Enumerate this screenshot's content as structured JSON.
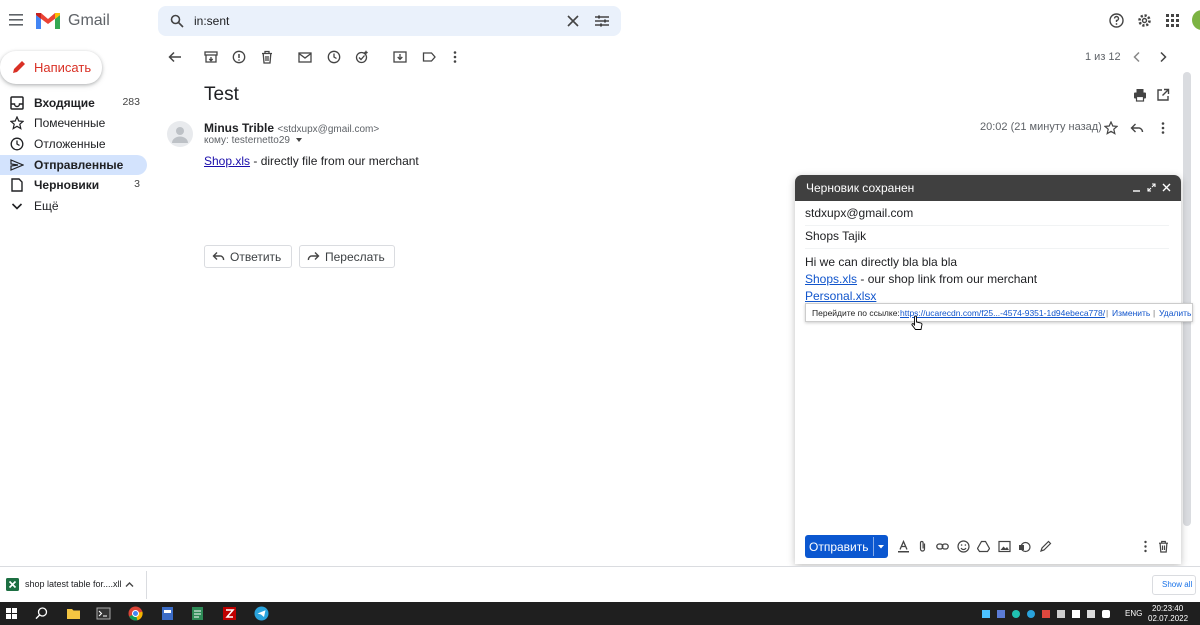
{
  "header": {
    "app_name": "Gmail",
    "search_value": "in:sent"
  },
  "sidebar": {
    "compose_label": "Написать",
    "items": [
      {
        "label": "Входящие",
        "count": "283"
      },
      {
        "label": "Помеченные",
        "count": ""
      },
      {
        "label": "Отложенные",
        "count": ""
      },
      {
        "label": "Отправленные",
        "count": ""
      },
      {
        "label": "Черновики",
        "count": "3"
      },
      {
        "label": "Ещё",
        "count": ""
      }
    ]
  },
  "toolbar": {
    "pagination": "1 из 12"
  },
  "message": {
    "subject": "Test",
    "sender_name": "Minus Trible",
    "sender_email": "<stdxupx@gmail.com>",
    "recipient": "кому: testernetto29",
    "time": "20:02 (21 минуту назад)",
    "attachment_link": "Shop.xls",
    "body_text": " - directly file from our merchant",
    "reply_label": "Ответить",
    "forward_label": "Переслать"
  },
  "compose": {
    "title": "Черновик сохранен",
    "to": "stdxupx@gmail.com",
    "subject": "Shops Tajik",
    "body_line1": "Hi we can directly bla bla bla",
    "link1": "Shops.xls",
    "body_line2_rest": " - our shop link from our merchant",
    "link2": "Personal.xlsx",
    "popup_prefix": "Перейдите по ссылке:",
    "popup_url": "https://ucarecdn.com/f25...-4574-9351-1d94ebeca778/",
    "popup_sep": "|",
    "popup_edit": "Изменить",
    "popup_delete": "Удалить",
    "send_label": "Отправить"
  },
  "downloads": {
    "file_name": "shop latest table for....xll",
    "show_all": "Show all"
  },
  "taskbar": {
    "lang": "ENG",
    "time": "20:23:40",
    "date": "02.07.2022"
  },
  "colors": {
    "accent": "#0b57d0",
    "active_nav": "#d3e3fd",
    "compose_header": "#404040",
    "link": "#1a0dab"
  }
}
